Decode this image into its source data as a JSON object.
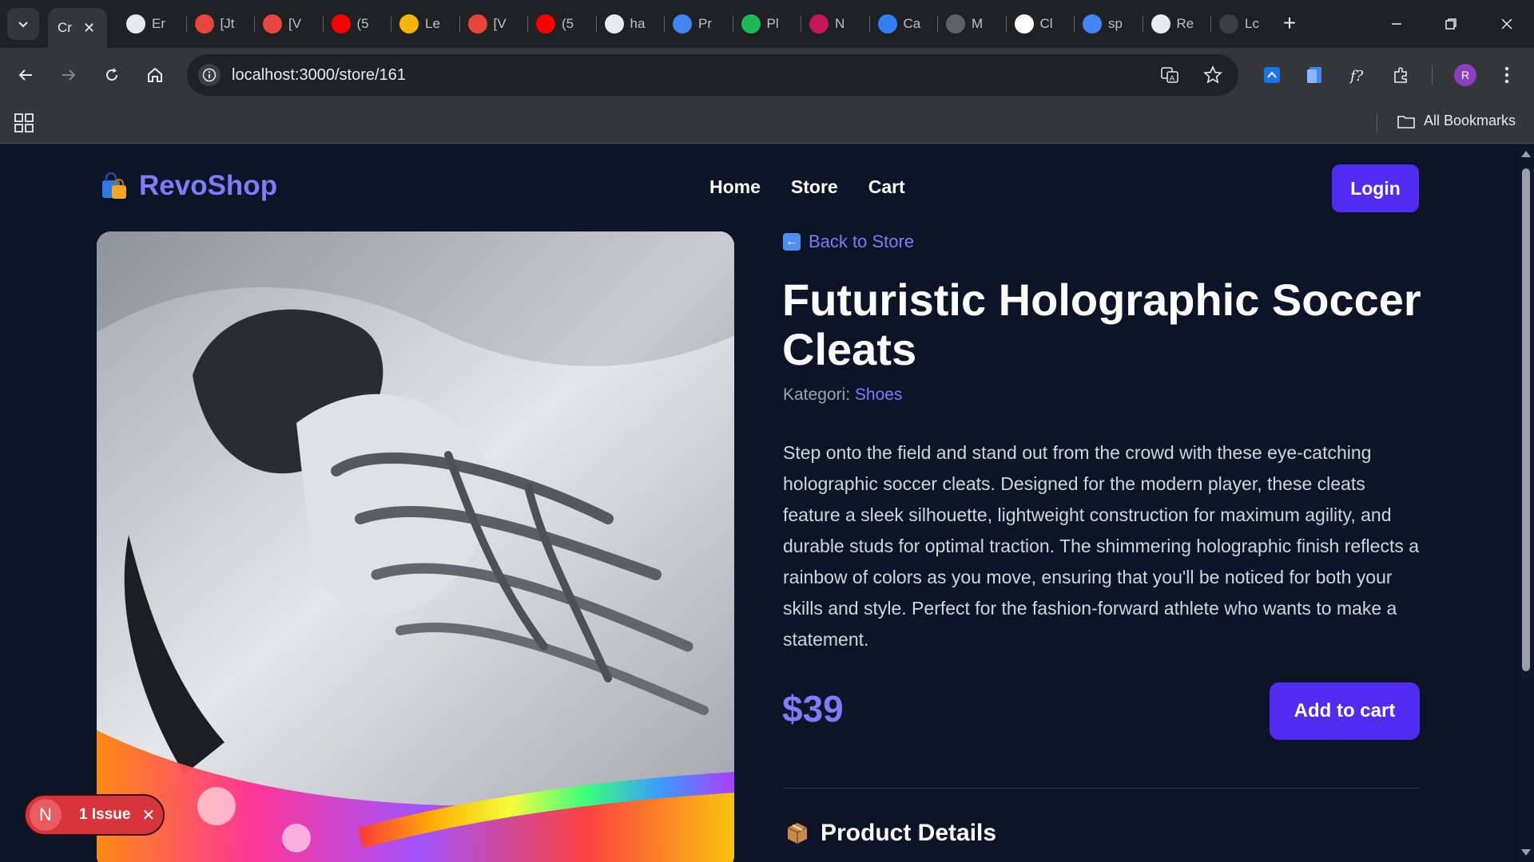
{
  "browser": {
    "tabs": [
      {
        "title": "Cr",
        "icon": "page-icon",
        "color": "#9aa0a6",
        "active": true
      },
      {
        "title": "Er",
        "icon": "openai-icon",
        "color": "#e8eaed"
      },
      {
        "title": "[Jt",
        "icon": "gear-red-icon",
        "color": "#e8453c"
      },
      {
        "title": "[V",
        "icon": "gear-red-icon",
        "color": "#e8453c"
      },
      {
        "title": "(5",
        "icon": "youtube-icon",
        "color": "#ff0000"
      },
      {
        "title": "Le",
        "icon": "slides-icon",
        "color": "#f4b400"
      },
      {
        "title": "[V",
        "icon": "gear-red-icon",
        "color": "#e8453c"
      },
      {
        "title": "(5",
        "icon": "youtube-icon",
        "color": "#ff0000"
      },
      {
        "title": "ha",
        "icon": "github-icon",
        "color": "#e8eaed"
      },
      {
        "title": "Pr",
        "icon": "docs-icon",
        "color": "#4285f4"
      },
      {
        "title": "Pl",
        "icon": "diamond-icon",
        "color": "#1db954"
      },
      {
        "title": "N",
        "icon": "squares-icon",
        "color": "#c2185b"
      },
      {
        "title": "Ca",
        "icon": "circle-blue-icon",
        "color": "#2f80ed"
      },
      {
        "title": "M",
        "icon": "page-icon",
        "color": "#5f6368"
      },
      {
        "title": "Cl",
        "icon": "triangle-icon",
        "color": "#ffffff"
      },
      {
        "title": "sp",
        "icon": "google-icon",
        "color": "#4285f4"
      },
      {
        "title": "Re",
        "icon": "github-icon",
        "color": "#e8eaed"
      },
      {
        "title": "Lc",
        "icon": "page-icon",
        "color": "#3c4043"
      }
    ],
    "url": "localhost:3000/store/161",
    "avatar_letter": "R",
    "all_bookmarks": "All Bookmarks"
  },
  "site": {
    "brand": "RevoShop",
    "nav": [
      "Home",
      "Store",
      "Cart"
    ],
    "login": "Login"
  },
  "product": {
    "back_label": "Back to Store",
    "title": "Futuristic Holographic Soccer Cleats",
    "category_label": "Kategori:",
    "category": "Shoes",
    "description": "Step onto the field and stand out from the crowd with these eye-catching holographic soccer cleats. Designed for the modern player, these cleats feature a sleek silhouette, lightweight construction for maximum agility, and durable studs for optimal traction. The shimmering holographic finish reflects a rainbow of colors as you move, ensuring that you'll be noticed for both your skills and style. Perfect for the fashion-forward athlete who wants to make a statement.",
    "price": "$39",
    "add_to_cart": "Add to cart",
    "details_heading": "Product Details"
  },
  "dev_overlay": {
    "letter": "N",
    "issues": "1 Issue"
  },
  "colors": {
    "accent": "#7d7cf9",
    "button": "#4f2cf0",
    "page_bg": "#0c1427"
  }
}
